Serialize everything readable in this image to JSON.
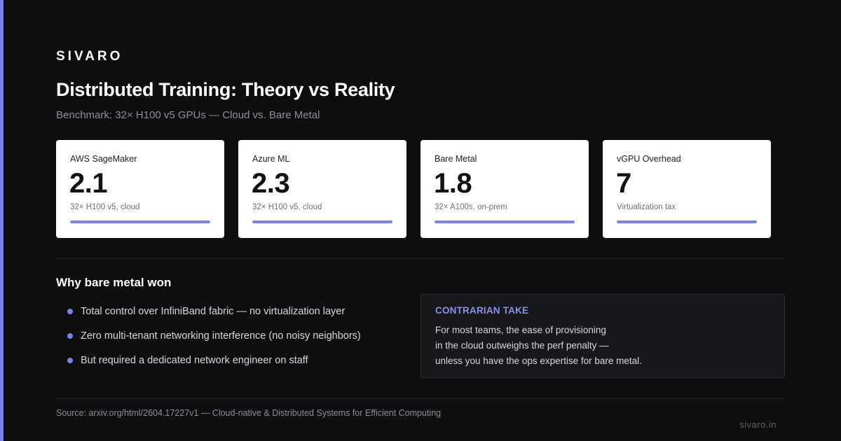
{
  "brand": "SIVARO",
  "title": "Distributed Training: Theory vs Reality",
  "subtitle": "Benchmark: 32× H100 v5 GPUs — Cloud vs. Bare Metal",
  "cards": [
    {
      "label": "AWS SageMaker",
      "value": "2.1",
      "note": "32× H100 v5, cloud",
      "bar_fraction": 1.0
    },
    {
      "label": "Azure ML",
      "value": "2.3",
      "note": "32× H100 v5, cloud",
      "bar_fraction": 1.0
    },
    {
      "label": "Bare Metal",
      "value": "1.8",
      "note": "32× A100s, on-prem",
      "bar_fraction": 1.0
    },
    {
      "label": "vGPU Overhead",
      "value": "7",
      "note": "Virtualization tax",
      "bar_fraction": 1.0
    }
  ],
  "reasons": {
    "title": "Why bare metal won",
    "items": [
      "Total control over InfiniBand fabric — no virtualization layer",
      "Zero multi-tenant networking interference (no noisy neighbors)",
      "But required a dedicated network engineer on staff"
    ]
  },
  "callout": {
    "label": "CONTRARIAN TAKE",
    "lines": [
      "For most teams, the ease of provisioning",
      "in the cloud outweighs the perf penalty —",
      "unless you have the ops expertise for bare metal."
    ]
  },
  "source": "Source: arxiv.org/html/2604.17227v1 — Cloud-native & Distributed Systems for Efficient Computing",
  "footer_domain": "sivaro.in",
  "colors": {
    "background": "#0e0e0f",
    "accent": "#7b82ea",
    "card_background": "#ffffff",
    "callout_label": "#8a90f0"
  }
}
